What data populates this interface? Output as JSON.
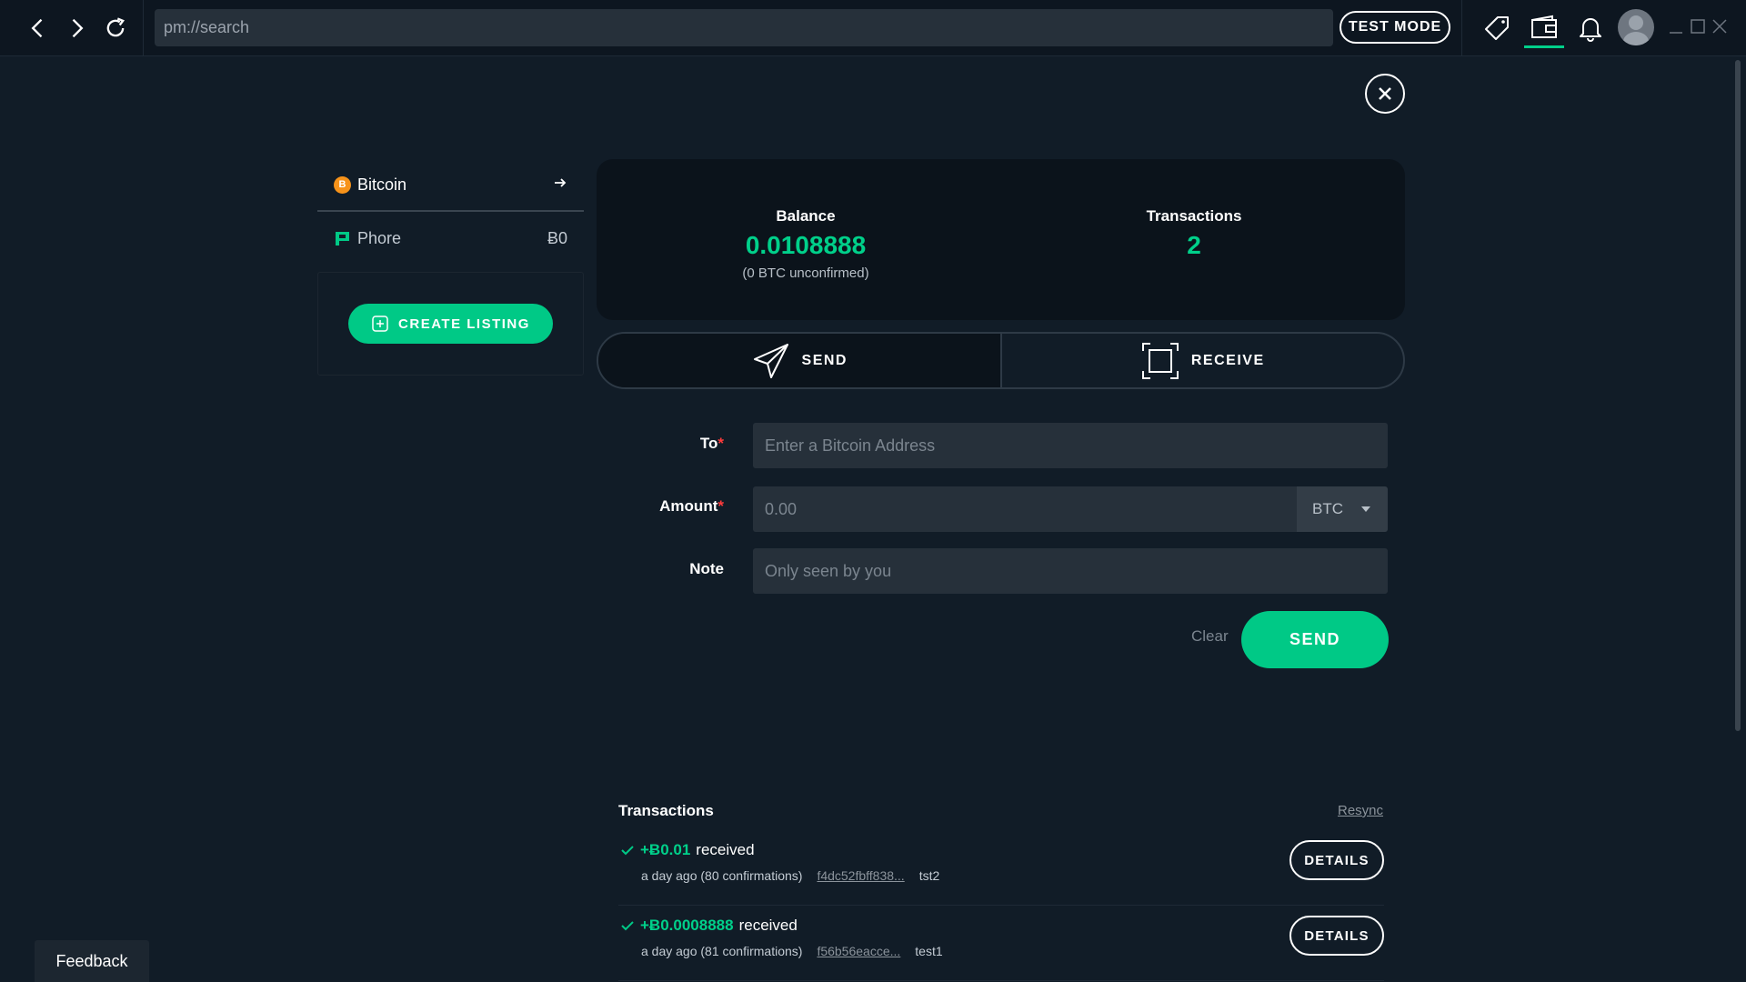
{
  "browser": {
    "address": "pm://search",
    "test_mode_label": "TEST MODE"
  },
  "icons": {
    "back": "chevron-left-icon",
    "forward": "chevron-right-icon",
    "reload": "reload-icon",
    "listings": "tag-icon",
    "wallet": "wallet-icon",
    "notifications": "bell-icon",
    "close": "close-icon"
  },
  "colors": {
    "accent": "#00c986",
    "background": "#111c27",
    "required": "#ff3b3b"
  },
  "sidebar": {
    "coins": [
      {
        "name": "Bitcoin",
        "icon_glyph": "B",
        "active": true
      },
      {
        "name": "Phore",
        "balance": "Ƀ0",
        "active": false
      }
    ],
    "create_listing_label": "CREATE LISTING"
  },
  "stats": {
    "balance_label": "Balance",
    "balance_value": "0.0108888",
    "balance_sub": "(0 BTC unconfirmed)",
    "transactions_label": "Transactions",
    "transactions_value": "2"
  },
  "tabs": {
    "send_label": "SEND",
    "receive_label": "RECEIVE",
    "active": "send"
  },
  "form": {
    "to_label": "To",
    "to_placeholder": "Enter a Bitcoin Address",
    "amount_label": "Amount",
    "amount_placeholder": "0.00",
    "currency": "BTC",
    "note_label": "Note",
    "note_placeholder": "Only seen by you",
    "required_mark": "*",
    "clear_label": "Clear",
    "send_label": "SEND"
  },
  "transactions": {
    "title": "Transactions",
    "resync_label": "Resync",
    "items": [
      {
        "amount": "+Ƀ0.01",
        "direction": "received",
        "meta": "a day ago (80 confirmations)",
        "hash": "f4dc52fbff838...",
        "memo": "tst2",
        "details_label": "DETAILS"
      },
      {
        "amount": "+Ƀ0.0008888",
        "direction": "received",
        "meta": "a day ago (81 confirmations)",
        "hash": "f56b56eacce...",
        "memo": "test1",
        "details_label": "DETAILS"
      }
    ]
  },
  "feedback_label": "Feedback"
}
